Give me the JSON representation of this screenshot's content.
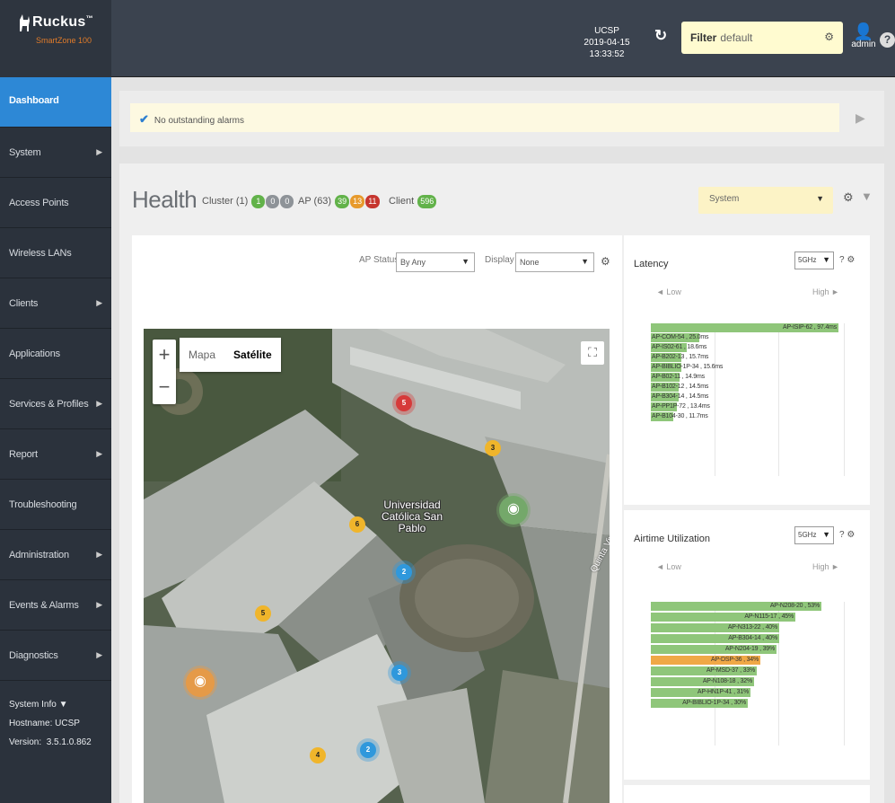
{
  "brand": {
    "name": "Ruckus",
    "tm": "™",
    "subtitle": "SmartZone 100"
  },
  "header": {
    "cluster_name": "UCSP",
    "datetime": "2019-04-15 13:33:52",
    "filter_label": "Filter",
    "filter_value": "default",
    "user": "admin"
  },
  "sidebar": {
    "items": [
      {
        "label": "Dashboard",
        "active": true,
        "has_submenu": false
      },
      {
        "label": "System",
        "has_submenu": true
      },
      {
        "label": "Access Points",
        "has_submenu": false
      },
      {
        "label": "Wireless LANs",
        "has_submenu": false
      },
      {
        "label": "Clients",
        "has_submenu": true
      },
      {
        "label": "Applications",
        "has_submenu": false
      },
      {
        "label": "Services & Profiles",
        "has_submenu": true
      },
      {
        "label": "Report",
        "has_submenu": true
      },
      {
        "label": "Troubleshooting",
        "has_submenu": false
      },
      {
        "label": "Administration",
        "has_submenu": true
      },
      {
        "label": "Events & Alarms",
        "has_submenu": true
      },
      {
        "label": "Diagnostics",
        "has_submenu": true
      }
    ],
    "system_info": {
      "title": "System Info ▼",
      "hostname_label": "Hostname:",
      "hostname": "UCSP",
      "version_label": "Version:",
      "version": "3.5.1.0.862"
    }
  },
  "alarms": {
    "message": "No outstanding alarms"
  },
  "health": {
    "title": "Health",
    "cluster_label": "Cluster (1)",
    "cluster_counts": [
      "1",
      "0",
      "0"
    ],
    "ap_label": "AP (63)",
    "ap_counts": [
      "39",
      "13",
      "11"
    ],
    "client_label": "Client",
    "client_count": "596",
    "scope_value": "System"
  },
  "map_controls": {
    "ap_status_label": "AP Status",
    "ap_status_value": "By Any",
    "display_label": "Display",
    "display_value": "None",
    "zoom_in": "+",
    "zoom_out": "−",
    "map_type_options": [
      "Mapa",
      "Satélite"
    ],
    "selected_map_type": "Satélite",
    "place_label": "Universidad Católica San Pablo",
    "street_label": "Quinta Vivanco"
  },
  "map_markers": [
    {
      "count": "5",
      "color": "red"
    },
    {
      "count": "3",
      "color": "orange"
    },
    {
      "count": "6",
      "color": "orange"
    },
    {
      "count": "2",
      "color": "blue"
    },
    {
      "count": "5",
      "color": "orange"
    },
    {
      "count": "3",
      "color": "blue"
    },
    {
      "count": "4",
      "color": "orange"
    },
    {
      "count": "2",
      "color": "blue"
    }
  ],
  "latency": {
    "title": "Latency",
    "band": "5GHz",
    "low_label": "◄ Low",
    "high_label": "High ►",
    "max": 100,
    "bars": [
      {
        "label": "AP-ISIP-62 , 97.4ms",
        "value": 97.4,
        "color": "#8fc67a"
      },
      {
        "label": "AP-COM-54 , 25.0ms",
        "value": 25.0,
        "color": "#8fc67a"
      },
      {
        "label": "AP-IS02-61 , 18.6ms",
        "value": 18.6,
        "color": "#8fc67a"
      },
      {
        "label": "AP-B202-13 , 15.7ms",
        "value": 15.7,
        "color": "#8fc67a"
      },
      {
        "label": "AP-BIBLIO-1P-34 , 15.6ms",
        "value": 15.6,
        "color": "#8fc67a"
      },
      {
        "label": "AP-B02-11 , 14.9ms",
        "value": 14.9,
        "color": "#8fc67a"
      },
      {
        "label": "AP-B102-12 , 14.5ms",
        "value": 14.5,
        "color": "#8fc67a"
      },
      {
        "label": "AP-B304-14 , 14.5ms",
        "value": 14.5,
        "color": "#8fc67a"
      },
      {
        "label": "AP-PP1P-72 , 13.4ms",
        "value": 13.4,
        "color": "#8fc67a"
      },
      {
        "label": "AP-B104-30 , 11.7ms",
        "value": 11.7,
        "color": "#8fc67a"
      }
    ]
  },
  "airtime": {
    "title": "Airtime Utilization",
    "band": "5GHz",
    "low_label": "◄ Low",
    "high_label": "High ►",
    "max": 60,
    "bars": [
      {
        "label": "AP-N208-20 , 53%",
        "value": 53,
        "color": "#8fc67a"
      },
      {
        "label": "AP-N115-17 , 45%",
        "value": 45,
        "color": "#8fc67a"
      },
      {
        "label": "AP-N313-22 , 40%",
        "value": 40,
        "color": "#8fc67a"
      },
      {
        "label": "AP-B304-14 , 40%",
        "value": 40,
        "color": "#8fc67a"
      },
      {
        "label": "AP-N204-19 , 39%",
        "value": 39,
        "color": "#8fc67a"
      },
      {
        "label": "AP-DSP-36 , 34%",
        "value": 34,
        "color": "#f0a846"
      },
      {
        "label": "AP-MSD-37 , 33%",
        "value": 33,
        "color": "#8fc67a"
      },
      {
        "label": "AP-N108-18 , 32%",
        "value": 32,
        "color": "#8fc67a"
      },
      {
        "label": "AP-HN1P-41 , 31%",
        "value": 31,
        "color": "#8fc67a"
      },
      {
        "label": "AP-BIBLIO-1P-34 , 30%",
        "value": 30,
        "color": "#8fc67a"
      }
    ]
  },
  "colors": {
    "accent": "#2d88d6",
    "sidebar": "#2b323c",
    "header": "#3b434f",
    "ok": "#62b24a",
    "warn": "#e79a2c",
    "critical": "#c6362f"
  }
}
